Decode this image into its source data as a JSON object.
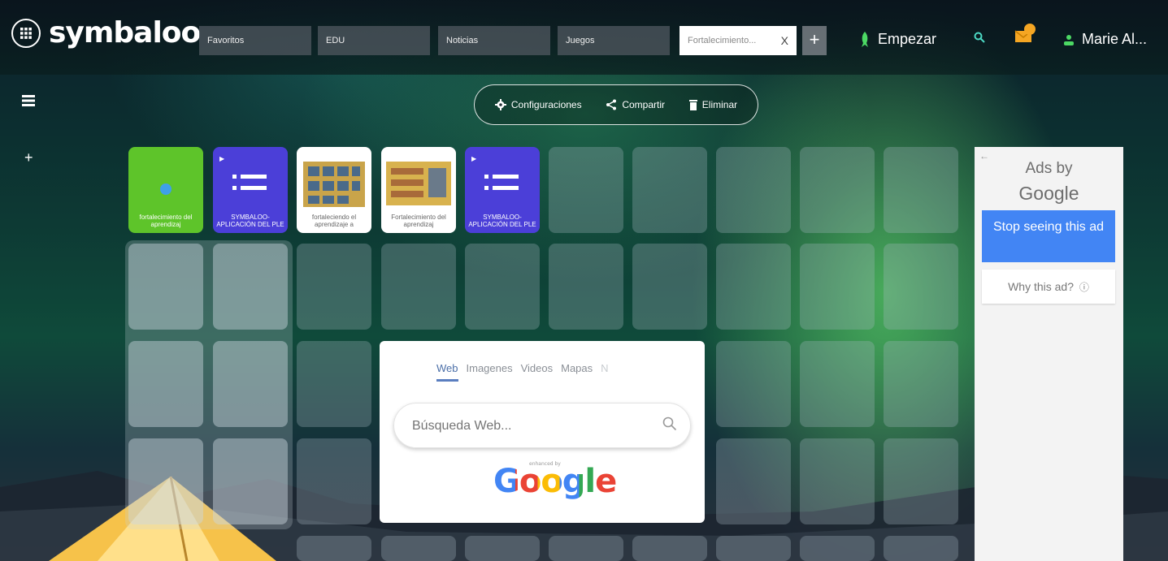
{
  "header": {
    "logo": "symbaloo",
    "tabs": [
      {
        "label": "Favoritos"
      },
      {
        "label": "EDU"
      },
      {
        "label": "Noticias"
      },
      {
        "label": "Juegos"
      },
      {
        "label": "Fortalecimiento...",
        "active": true
      }
    ],
    "close_glyph": "X",
    "add_glyph": "+",
    "start_label": "Empezar",
    "user_name": "Marie Al..."
  },
  "toolbar": {
    "settings_label": "Configuraciones",
    "share_label": "Compartir",
    "delete_label": "Eliminar"
  },
  "side": {
    "add_glyph": "+"
  },
  "tiles": [
    {
      "label": "fortalecimiento del aprendizaj",
      "color": "#5ec42a"
    },
    {
      "label": "SYMBALOO- APLICACIÓN DEL PLE",
      "color": "#4b3fd8"
    },
    {
      "label": "fortaleciendo el aprendizaje a",
      "color": "#ffffff"
    },
    {
      "label": "Fortalecimiento del aprendizaj",
      "color": "#ffffff"
    },
    {
      "label": "SYMBALOO- APLICACIÓN DEL PLE",
      "color": "#4b3fd8"
    }
  ],
  "search_widget": {
    "tabs": [
      "Web",
      "Imagenes",
      "Videos",
      "Mapas",
      "N"
    ],
    "placeholder": "Búsqueda Web...",
    "enhanced": "enhanced by",
    "google": "Google"
  },
  "ad": {
    "back_glyph": "←",
    "title_line1": "Ads by",
    "title_line2": "Google",
    "stop_label": "Stop seeing this ad",
    "why_label": "Why this ad?",
    "info_glyph": "ⓘ"
  },
  "colors": {
    "accent_blue": "#4285f4",
    "tile_green": "#5ec42a",
    "tile_purple": "#4b3fd8",
    "empezar_green": "#4cd964",
    "mail_orange": "#f5a623"
  }
}
